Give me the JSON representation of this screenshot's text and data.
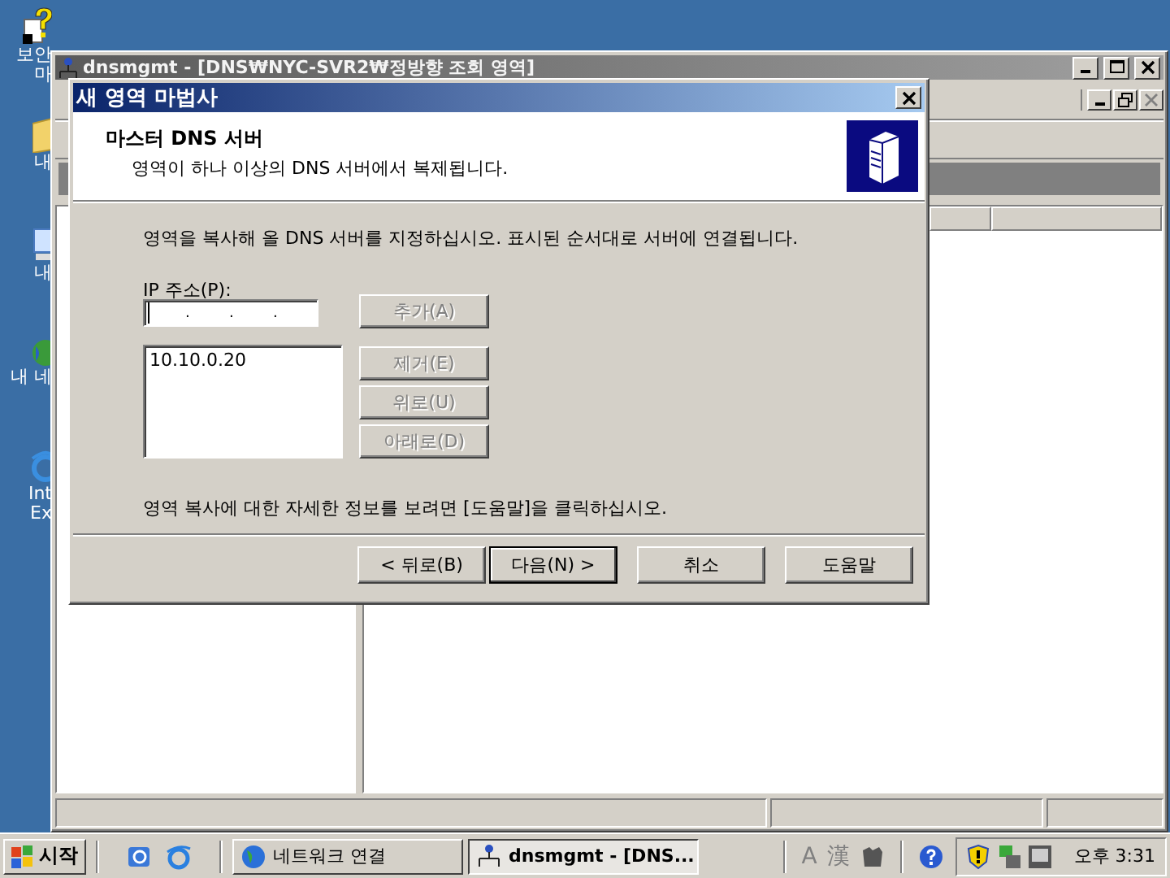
{
  "desktop_icons": [
    {
      "kind": "help",
      "lines": [
        "보안",
        "마"
      ]
    },
    {
      "kind": "folder",
      "lines": [
        "내"
      ]
    },
    {
      "kind": "computer",
      "lines": [
        "내"
      ]
    },
    {
      "kind": "globe",
      "lines": [
        "내 네"
      ]
    },
    {
      "kind": "browser",
      "lines": [
        "Int",
        "Ex"
      ]
    }
  ],
  "mmc_window": {
    "title": "dnsmgmt - [DNS₩NYC-SVR2₩정방향 조회 영역]",
    "active": false
  },
  "wizard": {
    "title": "새 영역 마법사",
    "active": true,
    "header_title": "마스터 DNS 서버",
    "header_subtitle": "영역이 하나 이상의 DNS 서버에서 복제됩니다.",
    "instruction": "영역을 복사해 올 DNS 서버를 지정하십시오. 표시된 순서대로 서버에 연결됩니다.",
    "ip_label": "IP 주소(P):",
    "ip_field": {
      "separator": "."
    },
    "ip_list": [
      {
        "text": "10.10.0.20",
        "selected": false
      }
    ],
    "side_buttons": [
      {
        "label": "추가(A)",
        "disabled": true
      },
      {
        "label": "제거(E)",
        "disabled": true
      },
      {
        "label": "위로(U)",
        "disabled": true
      },
      {
        "label": "아래로(D)",
        "disabled": true
      }
    ],
    "help_text": "영역 복사에 대한 자세한 정보를 보려면 [도움말]을 클릭하십시오.",
    "nav_buttons": [
      {
        "label": "< 뒤로(B)",
        "default": false
      },
      {
        "label": "다음(N) >",
        "default": true
      },
      {
        "label": "취소",
        "default": false
      },
      {
        "label": "도움말",
        "default": false
      }
    ]
  },
  "taskbar": {
    "start": "시작",
    "tasks": [
      {
        "label": "네트워크 연결",
        "selected": false,
        "kind": "globe"
      },
      {
        "label": "dnsmgmt - [DNS...",
        "selected": true,
        "kind": "network"
      }
    ],
    "language_bar": [
      "A",
      "漢"
    ],
    "clock": "오후 3:31"
  }
}
